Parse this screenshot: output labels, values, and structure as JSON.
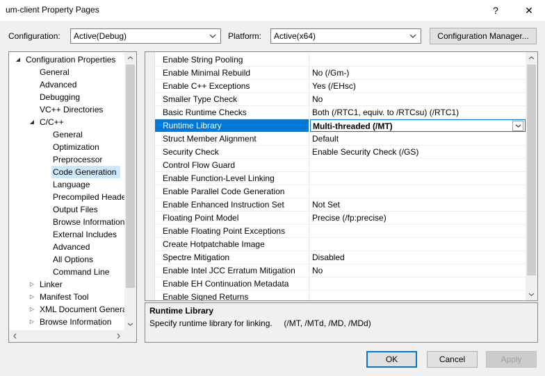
{
  "window": {
    "title": "um-client Property Pages",
    "help_glyph": "?",
    "close_glyph": "✕"
  },
  "config_row": {
    "configuration_label": "Configuration:",
    "configuration_value": "Active(Debug)",
    "platform_label": "Platform:",
    "platform_value": "Active(x64)",
    "manager_button": "Configuration Manager..."
  },
  "tree": {
    "items": [
      {
        "label": "Configuration Properties",
        "expander": "◢"
      },
      {
        "label": "General"
      },
      {
        "label": "Advanced"
      },
      {
        "label": "Debugging"
      },
      {
        "label": "VC++ Directories"
      },
      {
        "label": "C/C++",
        "expander": "◢"
      },
      {
        "label": "General"
      },
      {
        "label": "Optimization"
      },
      {
        "label": "Preprocessor"
      },
      {
        "label": "Code Generation",
        "selected": true
      },
      {
        "label": "Language"
      },
      {
        "label": "Precompiled Heade"
      },
      {
        "label": "Output Files"
      },
      {
        "label": "Browse Information"
      },
      {
        "label": "External Includes"
      },
      {
        "label": "Advanced"
      },
      {
        "label": "All Options"
      },
      {
        "label": "Command Line"
      },
      {
        "label": "Linker",
        "expander": "▷"
      },
      {
        "label": "Manifest Tool",
        "expander": "▷"
      },
      {
        "label": "XML Document Genera",
        "expander": "▷"
      },
      {
        "label": "Browse Information",
        "expander": "▷"
      }
    ]
  },
  "properties": {
    "rows": [
      {
        "name": "Enable String Pooling",
        "value": ""
      },
      {
        "name": "Enable Minimal Rebuild",
        "value": "No (/Gm-)"
      },
      {
        "name": "Enable C++ Exceptions",
        "value": "Yes (/EHsc)"
      },
      {
        "name": "Smaller Type Check",
        "value": "No"
      },
      {
        "name": "Basic Runtime Checks",
        "value": "Both (/RTC1, equiv. to /RTCsu) (/RTC1)"
      },
      {
        "name": "Runtime Library",
        "value": "Multi-threaded (/MT)",
        "selected": true
      },
      {
        "name": "Struct Member Alignment",
        "value": "Default"
      },
      {
        "name": "Security Check",
        "value": "Enable Security Check (/GS)"
      },
      {
        "name": "Control Flow Guard",
        "value": ""
      },
      {
        "name": "Enable Function-Level Linking",
        "value": ""
      },
      {
        "name": "Enable Parallel Code Generation",
        "value": ""
      },
      {
        "name": "Enable Enhanced Instruction Set",
        "value": "Not Set"
      },
      {
        "name": "Floating Point Model",
        "value": "Precise (/fp:precise)"
      },
      {
        "name": "Enable Floating Point Exceptions",
        "value": ""
      },
      {
        "name": "Create Hotpatchable Image",
        "value": ""
      },
      {
        "name": "Spectre Mitigation",
        "value": "Disabled"
      },
      {
        "name": "Enable Intel JCC Erratum Mitigation",
        "value": "No"
      },
      {
        "name": "Enable EH Continuation Metadata",
        "value": ""
      },
      {
        "name": "Enable Signed Returns",
        "value": ""
      }
    ]
  },
  "description": {
    "title": "Runtime Library",
    "text": "Specify runtime library for linking.     (/MT, /MTd, /MD, /MDd)"
  },
  "buttons": {
    "ok": "OK",
    "cancel": "Cancel",
    "apply": "Apply"
  },
  "colors": {
    "selection_blue": "#0078d7",
    "tree_selection": "#cce8ff",
    "dialog_bg": "#f0f0f0"
  }
}
